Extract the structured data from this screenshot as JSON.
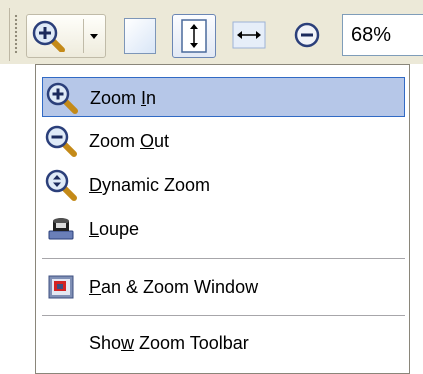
{
  "toolbar": {
    "zoom_value": "68%",
    "colors": {
      "background": "#ece9d8",
      "button_border": "#c0bba8",
      "field_border": "#7f9db9"
    },
    "buttons": [
      {
        "name": "zoom-split-button",
        "icon": "zoom-in-icon"
      },
      {
        "name": "fit-page-button",
        "icon": "page-icon"
      },
      {
        "name": "fit-height-button",
        "icon": "fit-height-icon"
      },
      {
        "name": "fit-width-button",
        "icon": "fit-width-icon"
      },
      {
        "name": "zoom-out-button",
        "icon": "zoom-out-icon"
      }
    ]
  },
  "menu": {
    "highlight_color": "#b6c7e8",
    "highlight_border": "#316ac5",
    "items": [
      {
        "pre": "Zoom ",
        "key": "I",
        "post": "n",
        "icon": "zoom-in-icon",
        "highlighted": true
      },
      {
        "pre": "Zoom ",
        "key": "O",
        "post": "ut",
        "icon": "zoom-out-icon",
        "highlighted": false
      },
      {
        "pre": "",
        "key": "D",
        "post": "ynamic Zoom",
        "icon": "dynamic-zoom-icon",
        "highlighted": false
      },
      {
        "pre": "",
        "key": "L",
        "post": "oupe",
        "icon": "loupe-icon",
        "highlighted": false
      },
      {
        "pre": "",
        "key": "P",
        "post": "an & Zoom Window",
        "icon": "pan-zoom-window-icon",
        "highlighted": false
      },
      {
        "pre": "Sho",
        "key": "w",
        "post": " Zoom Toolbar",
        "icon": "",
        "highlighted": false
      }
    ]
  }
}
